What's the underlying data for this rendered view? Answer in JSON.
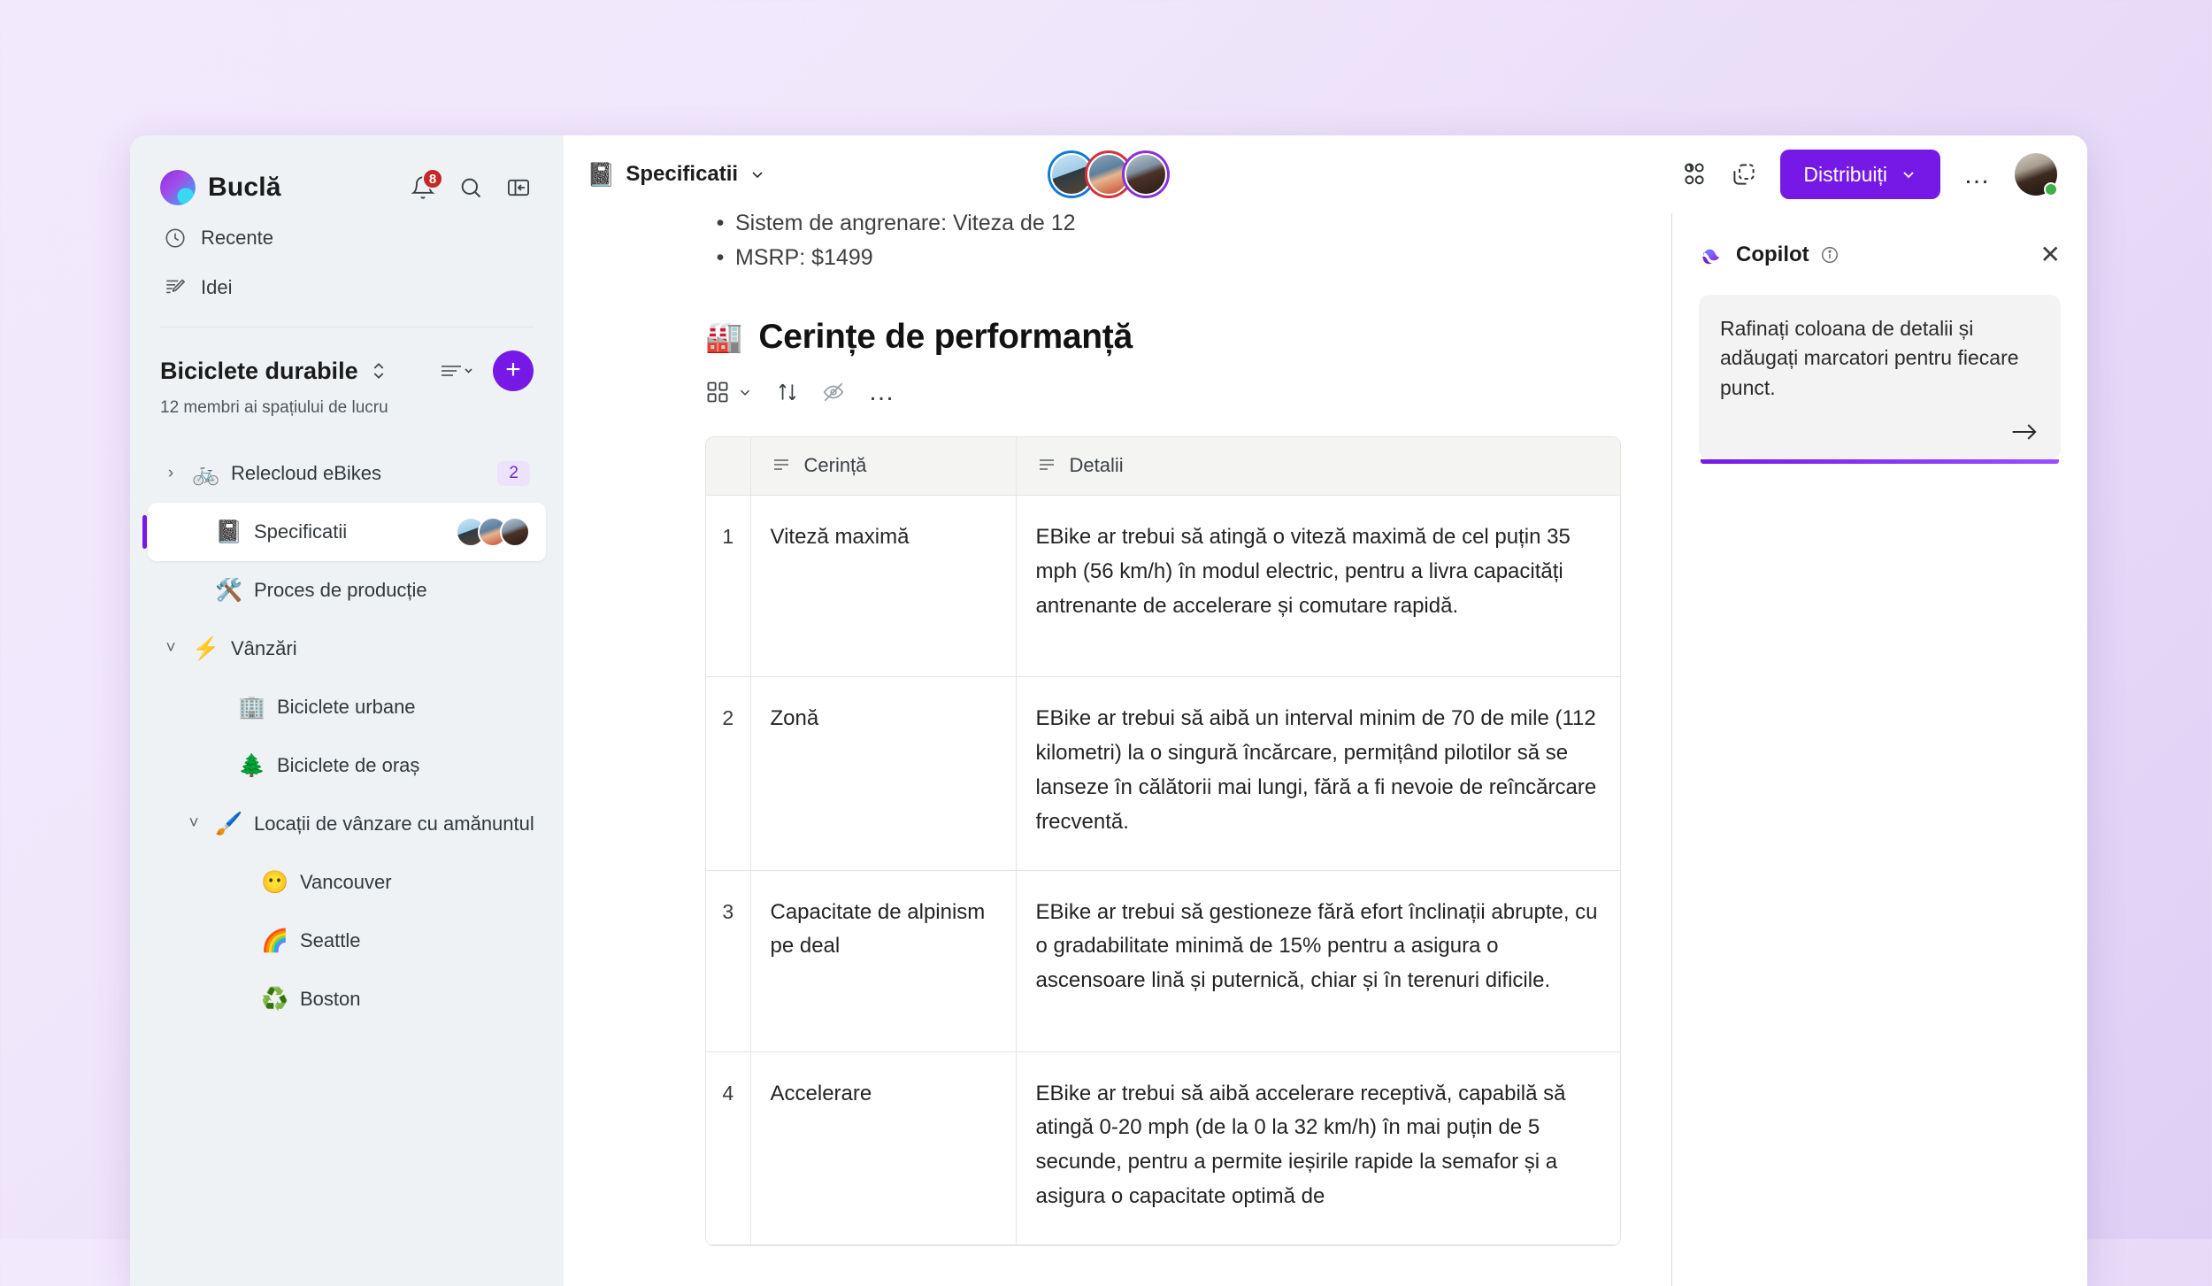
{
  "app": {
    "brand_name": "Buclă",
    "notifications_badge": "8"
  },
  "sidebar": {
    "links": [
      {
        "label": "Recente",
        "icon": "clock-icon"
      },
      {
        "label": "Idei",
        "icon": "notes-pencil-icon"
      }
    ],
    "workspace": {
      "title": "Biciclete durabile",
      "subtitle": "12 membri ai spațiului de lucru",
      "add_label": "+"
    },
    "tree": [
      {
        "label": "Relecloud eBikes",
        "emoji": "🚲",
        "chevron": "›",
        "count": "2",
        "indent": 0,
        "active": false
      },
      {
        "label": "Specificatii",
        "emoji": "📓",
        "chevron": "",
        "count": "",
        "indent": 1,
        "active": true
      },
      {
        "label": "Proces de producție",
        "emoji": "🛠️",
        "chevron": "",
        "count": "",
        "indent": 1,
        "active": false
      },
      {
        "label": "Vânzări",
        "emoji": "⚡",
        "chevron": "˅",
        "count": "",
        "indent": 0,
        "active": false
      },
      {
        "label": "Biciclete urbane",
        "emoji": "🏢",
        "chevron": "",
        "count": "",
        "indent": 2,
        "active": false
      },
      {
        "label": "Biciclete de oraș",
        "emoji": "🌲",
        "chevron": "",
        "count": "",
        "indent": 2,
        "active": false
      },
      {
        "label": "Locații de vânzare cu amănuntul",
        "emoji": "🖌️",
        "chevron": "˅",
        "count": "",
        "indent": 1,
        "active": false
      },
      {
        "label": "Vancouver",
        "emoji": "😶",
        "chevron": "",
        "count": "",
        "indent": 3,
        "active": false
      },
      {
        "label": "Seattle",
        "emoji": "🌈",
        "chevron": "",
        "count": "",
        "indent": 3,
        "active": false
      },
      {
        "label": "Boston",
        "emoji": "♻️",
        "chevron": "",
        "count": "",
        "indent": 3,
        "active": false
      }
    ]
  },
  "topbar": {
    "doc_title": "Specificatii",
    "share_label": "Distribuiți",
    "more_label": "…"
  },
  "document": {
    "bullets": [
      "Sistem de angrenare: Viteza de 12",
      "MSRP: $1499"
    ],
    "heading": "Cerințe de performanță",
    "heading_emoji": "🏭",
    "table": {
      "headers": [
        "",
        "Cerință",
        "Detalii"
      ],
      "rows": [
        {
          "num": "1",
          "requirement": "Viteză maximă",
          "details": "EBike ar trebui să atingă o viteză maximă de cel puțin 35 mph (56 km/h) în modul electric, pentru a livra capacități antrenante de accelerare și comutare rapidă."
        },
        {
          "num": "2",
          "requirement": "Zonă",
          "details": "EBike ar trebui să aibă un interval minim de 70 de mile (112 kilometri) la o singură încărcare, permițând pilotilor să se lanseze în călătorii mai lungi, fără a fi nevoie de reîncărcare frecventă."
        },
        {
          "num": "3",
          "requirement": "Capacitate de alpinism pe deal",
          "details": "EBike ar trebui să gestioneze fără efort înclinații abrupte, cu o gradabilitate minimă de 15% pentru a asigura o ascensoare lină și puternică, chiar și în terenuri dificile."
        },
        {
          "num": "4",
          "requirement": "Accelerare",
          "details": "EBike ar trebui să aibă accelerare receptivă, capabilă să atingă 0-20 mph (de la 0 la 32 km/h) în mai puțin de 5 secunde, pentru a permite ieșirile rapide la semafor și a asigura o capacitate optimă de"
        }
      ]
    }
  },
  "copilot": {
    "title": "Copilot",
    "prompt": "Rafinați coloana de detalii și adăugați marcatori pentru fiecare punct.",
    "close_label": "✕"
  },
  "colors": {
    "accent": "#7719e6",
    "badge_red": "#c62828",
    "sidebar_bg": "#eef2f4",
    "presence_green": "#3faf46",
    "ring_blue": "#0f7bd8",
    "ring_red": "#d6303a",
    "ring_purple": "#8b2fd6"
  }
}
